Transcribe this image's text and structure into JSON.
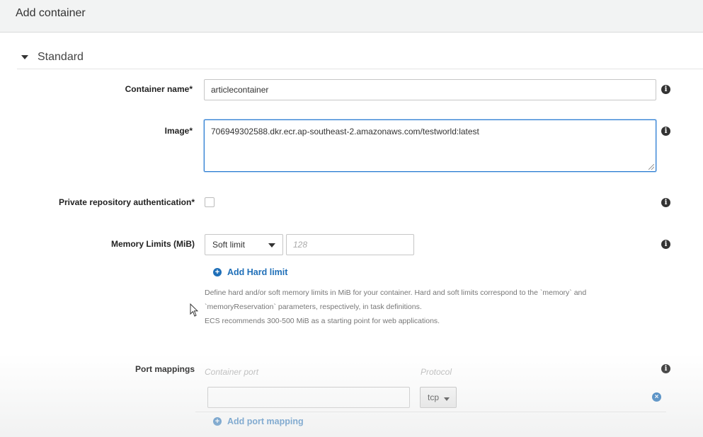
{
  "window": {
    "title": "Add container"
  },
  "section": {
    "label": "Standard"
  },
  "fields": {
    "container_name": {
      "label": "Container name*",
      "value": "articlecontainer"
    },
    "image": {
      "label": "Image*",
      "value": "706949302588.dkr.ecr.ap-southeast-2.amazonaws.com/testworld:latest"
    },
    "private_repo_auth": {
      "label": "Private repository authentication*",
      "checked": false
    },
    "memory_limits": {
      "label": "Memory Limits (MiB)",
      "select_value": "Soft limit",
      "input_placeholder": "128",
      "add_link": "Add Hard limit",
      "help_line1": "Define hard and/or soft memory limits in MiB for your container. Hard and soft limits correspond to the `memory` and",
      "help_line2": "`memoryReservation` parameters, respectively, in task definitions.",
      "help_line3": "ECS recommends 300-500 MiB as a starting point for web applications."
    },
    "port_mappings": {
      "label": "Port mappings",
      "col_container_port": "Container port",
      "col_protocol": "Protocol",
      "container_port_value": "",
      "protocol_value": "tcp",
      "add_link": "Add port mapping"
    }
  },
  "icons": {
    "info": "info-icon",
    "add": "plus-circle-icon",
    "remove": "remove-circle-icon",
    "collapse": "caret-down-icon"
  },
  "colors": {
    "link": "#1f6fb8",
    "focus_border": "#2d7dd2",
    "titlebar_bg": "#f2f3f3"
  }
}
